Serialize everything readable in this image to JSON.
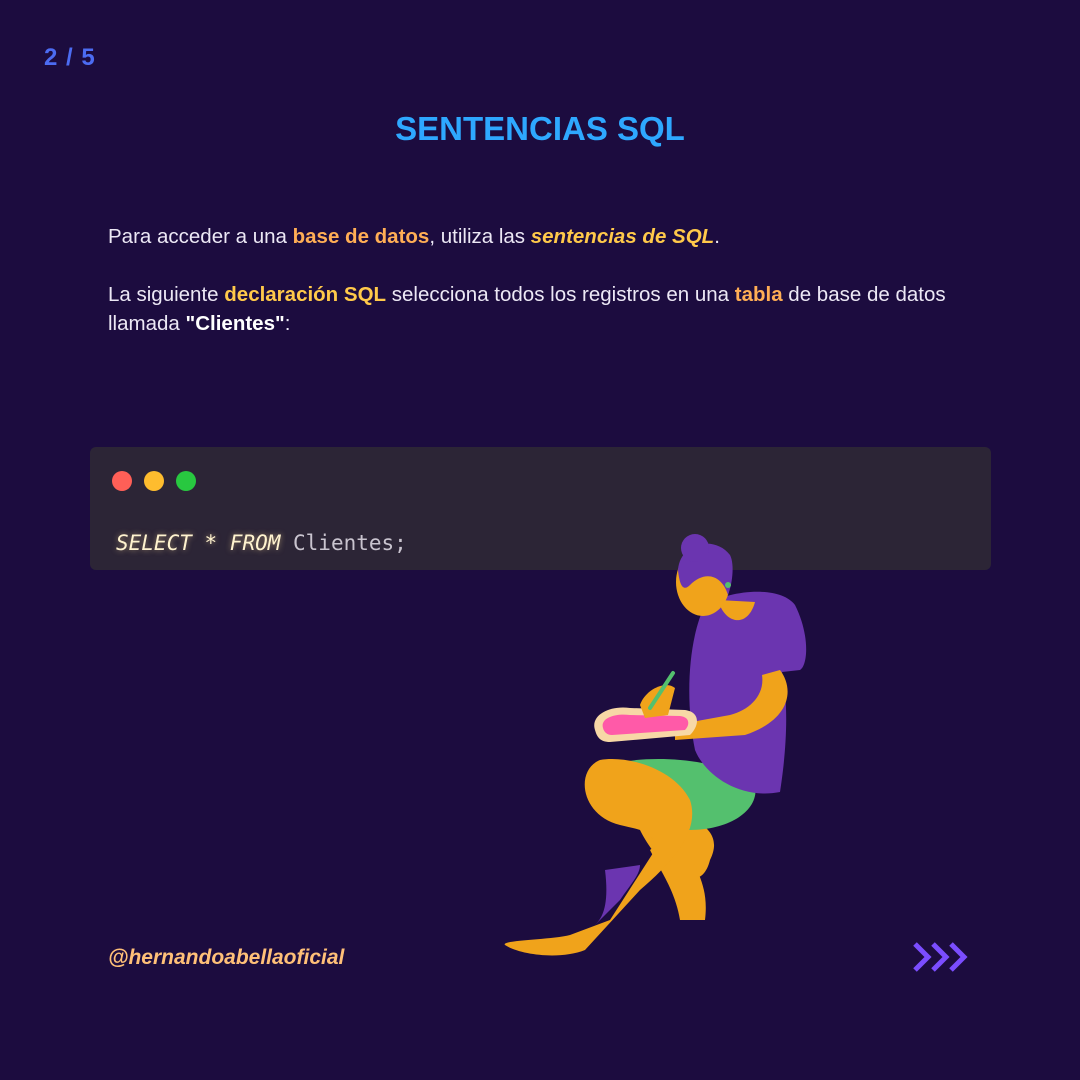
{
  "header": {
    "page_counter": "2 / 5",
    "title": "SENTENCIAS SQL"
  },
  "intro": {
    "p1": {
      "t1": "Para acceder a una ",
      "h1": "base de datos",
      "t2": ", utiliza las ",
      "h2": "sentencias de SQL",
      "t3": "."
    },
    "p2": {
      "t1": "La siguiente ",
      "h1": "declaración SQL",
      "t2": " selecciona todos los registros en una ",
      "h2": "tabla",
      "t3": " de base de datos llamada ",
      "h3": "\"Clientes\"",
      "t4": ":"
    }
  },
  "code": {
    "keyword1": "SELECT",
    "sep": " * ",
    "keyword2": "FROM",
    "rest": " Clientes;"
  },
  "footer": {
    "handle": "@hernandoabellaoficial",
    "next_icon": "triple-chevron-right-icon"
  },
  "colors": {
    "background": "#1c0c3f",
    "title": "#2ea8ff",
    "accent_orange": "#ffae55",
    "accent_yellow": "#ffc94a",
    "arrows": "#7b4dff"
  }
}
